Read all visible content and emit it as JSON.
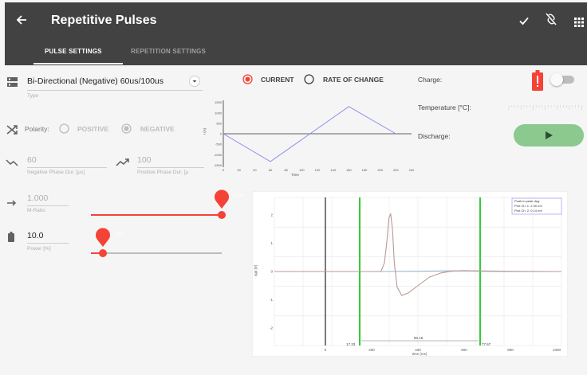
{
  "header": {
    "title": "Repetitive Pulses",
    "tabs": [
      {
        "label": "PULSE SETTINGS",
        "active": true
      },
      {
        "label": "REPETITION SETTINGS",
        "active": false
      }
    ],
    "icons": [
      "arrow-back-icon",
      "check-icon",
      "link-off-icon",
      "apps-grid-icon"
    ]
  },
  "pulse_type": {
    "value": "Bi-Directional (Negative) 60us/100us",
    "hint": "Type"
  },
  "polarity": {
    "label": "Polarity:",
    "options": [
      {
        "label": "POSITIVE",
        "selected": false
      },
      {
        "label": "NEGATIVE",
        "selected": true
      }
    ]
  },
  "phase": {
    "negative_value": "60",
    "negative_hint": "Negative Phase Dur. [µs]",
    "positive_value": "100",
    "positive_hint": "Positive Phase Dur. [µ"
  },
  "m_ratio": {
    "value": "1.000",
    "hint": "M-Ratio",
    "pin": "1.000",
    "level": 1.0
  },
  "power": {
    "value": "10.0",
    "hint": "Power [%]",
    "pin": "10.0",
    "level": 0.1
  },
  "mode": {
    "options": [
      {
        "label": "CURRENT",
        "selected": true
      },
      {
        "label": "RATE OF CHANGE",
        "selected": false
      }
    ]
  },
  "charge": {
    "label": "Charge:",
    "toggle_on": false
  },
  "temperature": {
    "label": "Temperature [°C]:"
  },
  "discharge": {
    "label": "Discharge:"
  },
  "colors": {
    "header_bg": "#424242",
    "accent_red": "#f44336",
    "discharge_green": "#8bc98f",
    "waveform_blue": "#8c8cf0",
    "scope_marker_green": "#33cc33"
  },
  "chart_data": [
    {
      "type": "line",
      "title": "",
      "xlabel": "Time",
      "ylabel": "I (A)",
      "xlim": [
        0,
        240
      ],
      "ylim": [
        -1600,
        1600
      ],
      "x_ticks": [
        "0",
        "20",
        "40",
        "60",
        "80",
        "100",
        "120",
        "140",
        "160",
        "180",
        "200",
        "220",
        "240"
      ],
      "y_ticks": [
        "1500",
        "1000",
        "500",
        "0",
        "-500",
        "-1000",
        "-1500"
      ],
      "series": [
        {
          "x": [
            0,
            60,
            160,
            220
          ],
          "y": [
            0,
            -1330,
            1300,
            0
          ]
        }
      ]
    },
    {
      "type": "line",
      "title": "",
      "xlabel": "time (ms)",
      "ylabel": "sgn [V]",
      "x_ticks": [
        "0",
        "200",
        "400",
        "600",
        "800",
        "1000"
      ],
      "y_ticks": [
        "2",
        "1",
        "0",
        "-1",
        "-2"
      ],
      "legend": {
        "position": "top-right",
        "title": "Peak to peak dsg:",
        "entries": [
          "Prot Ch. 1: 2.00 mV",
          "Prot Ch. 2: 0.14 mV"
        ]
      },
      "annotations": [
        "17.33",
        "80.15",
        "77.67"
      ],
      "series": [
        {
          "x": [
            0,
            240,
            255,
            265,
            275,
            282,
            290,
            298,
            310,
            330,
            360,
            400,
            450,
            500,
            550,
            600,
            700,
            800,
            900,
            1000
          ],
          "y": [
            0,
            0,
            0.3,
            1.0,
            1.9,
            2.05,
            1.5,
            0.3,
            -0.55,
            -0.85,
            -0.75,
            -0.5,
            -0.2,
            -0.05,
            0.02,
            0.03,
            0.01,
            0,
            0,
            0
          ]
        },
        {
          "x": [
            0,
            200,
            400,
            600,
            800,
            1000
          ],
          "y": [
            0,
            0,
            0.01,
            0.03,
            0.01,
            0
          ]
        }
      ]
    }
  ]
}
